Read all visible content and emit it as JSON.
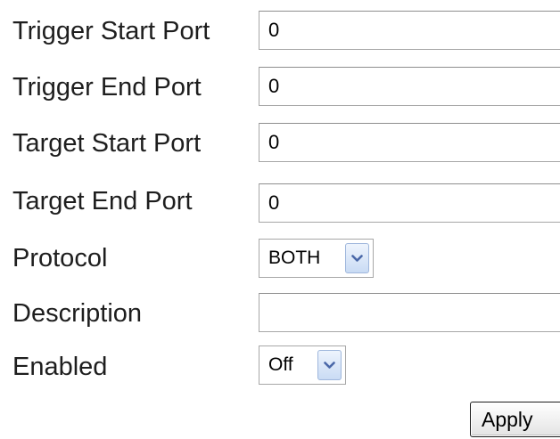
{
  "form": {
    "trigger_start_port": {
      "label": "Trigger Start Port",
      "value": "0"
    },
    "trigger_end_port": {
      "label": "Trigger End Port",
      "value": "0"
    },
    "target_start_port": {
      "label": "Target Start Port",
      "value": "0"
    },
    "target_end_port": {
      "label": "Target End Port",
      "value": "0"
    },
    "protocol": {
      "label": "Protocol",
      "selected": "BOTH"
    },
    "description": {
      "label": "Description",
      "value": ""
    },
    "enabled": {
      "label": "Enabled",
      "selected": "Off"
    },
    "apply_label": "Apply"
  },
  "icons": {
    "dropdown": "chevron-down-icon"
  },
  "colors": {
    "arrow_glyph": "#4a68a8",
    "input_border": "#a7a7a7"
  }
}
